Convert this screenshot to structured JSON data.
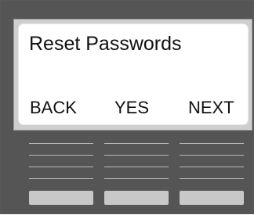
{
  "screen": {
    "title": "Reset Passwords"
  },
  "softkeys": {
    "left_label": "BACK",
    "center_label": "YES",
    "right_label": "NEXT"
  },
  "colors": {
    "device_body": "#555555",
    "bezel": "#cfcfcf",
    "screen_background": "#ffffff",
    "text": "#111111",
    "key": "#c8c8c8",
    "vent_lines": "#b9b9b9"
  }
}
